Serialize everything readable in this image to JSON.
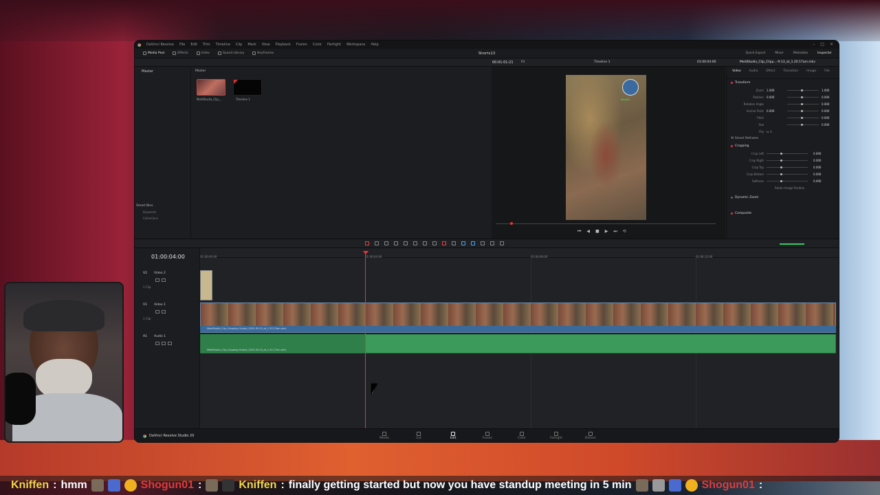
{
  "window": {
    "app_title": "DaVinci Resolve",
    "project_name": "Shorts13"
  },
  "menu": [
    "File",
    "Edit",
    "Trim",
    "Timeline",
    "Clip",
    "Mark",
    "View",
    "Playback",
    "Fusion",
    "Color",
    "Fairlight",
    "Workspace",
    "Help"
  ],
  "toolbar": {
    "left": [
      "Media Pool",
      "Effects",
      "Index",
      "Sound Library",
      "Keyframes"
    ],
    "right": [
      "Quick Export",
      "Mixer",
      "Metadata",
      "Inspector"
    ]
  },
  "subbar": {
    "fit": "Fit",
    "source_tc": "00:01:01:21",
    "timeline_name": "Timeline 1",
    "record_tc": "01:00:04:00",
    "clip_name": "MeldStudio_Clip_Clipp...-9-13_at_1.20.17am.mkv"
  },
  "bins": {
    "master": "Master",
    "smart_bins": "Smart Bins",
    "items": [
      "Keywords",
      "Collections"
    ]
  },
  "media_pool": {
    "header": "Master",
    "clips": [
      "MeldStudio_Clip_...",
      "Timeline 1"
    ]
  },
  "viewer": {
    "cam_label": "Nasdrix"
  },
  "inspector": {
    "tabs": [
      "Video",
      "Audio",
      "Effect",
      "Transition",
      "Image",
      "File"
    ],
    "transform_title": "Transform",
    "transform": [
      {
        "name": "Zoom",
        "x": "1.000",
        "y": "1.000"
      },
      {
        "name": "Position",
        "x": "0.000",
        "y": "0.000"
      },
      {
        "name": "Rotation Angle",
        "x": "",
        "y": "0.000"
      },
      {
        "name": "Anchor Point",
        "x": "0.000",
        "y": "0.000"
      },
      {
        "name": "Pitch",
        "x": "",
        "y": "0.000"
      },
      {
        "name": "Yaw",
        "x": "",
        "y": "0.000"
      },
      {
        "name": "Flip",
        "x": "",
        "y": ""
      }
    ],
    "smart_reframe": "AI Smart Reframe",
    "cropping_title": "Cropping",
    "cropping": [
      {
        "name": "Crop Left",
        "v": "0.000"
      },
      {
        "name": "Crop Right",
        "v": "0.000"
      },
      {
        "name": "Crop Top",
        "v": "0.000"
      },
      {
        "name": "Crop Bottom",
        "v": "0.000"
      },
      {
        "name": "Softness",
        "v": "0.000"
      }
    ],
    "retain": "Retain Image Position",
    "dynamic_zoom": "Dynamic Zoom",
    "composite": "Composite"
  },
  "timeline": {
    "timecode": "01:00:04:00",
    "ruler": [
      "01:00:00:00",
      "01:00:04:00",
      "01:00:08:00",
      "01:00:12:00"
    ],
    "tracks": [
      {
        "id": "V2",
        "name": "Video 2",
        "clips": "1 Clip"
      },
      {
        "id": "V1",
        "name": "Video 1",
        "clips": "1 Clip"
      },
      {
        "id": "A1",
        "name": "Audio 1",
        "clips": "2.0"
      }
    ],
    "v1_clip_name": "MeldStudio_Clip_Cropping Output_2025-09-13_at_1.20.17am.mkv",
    "a1_clip_name": "MeldStudio_Clip_Cropping Output_2025-09-13_at_1.20.17am.mkv"
  },
  "pages": {
    "brand": "DaVinci Resolve Studio 20",
    "tabs": [
      "Media",
      "Cut",
      "Edit",
      "Fusion",
      "Color",
      "Fairlight",
      "Deliver"
    ],
    "active": "Edit"
  },
  "chat": [
    {
      "user": "Kniffen",
      "msg": "hmm"
    },
    {
      "user": "Shogun01",
      "msg": ""
    },
    {
      "user": "Kniffen",
      "msg": "finally getting started but now you have standup meeting in 5 min"
    },
    {
      "user": "Shogun01",
      "msg": ""
    }
  ]
}
